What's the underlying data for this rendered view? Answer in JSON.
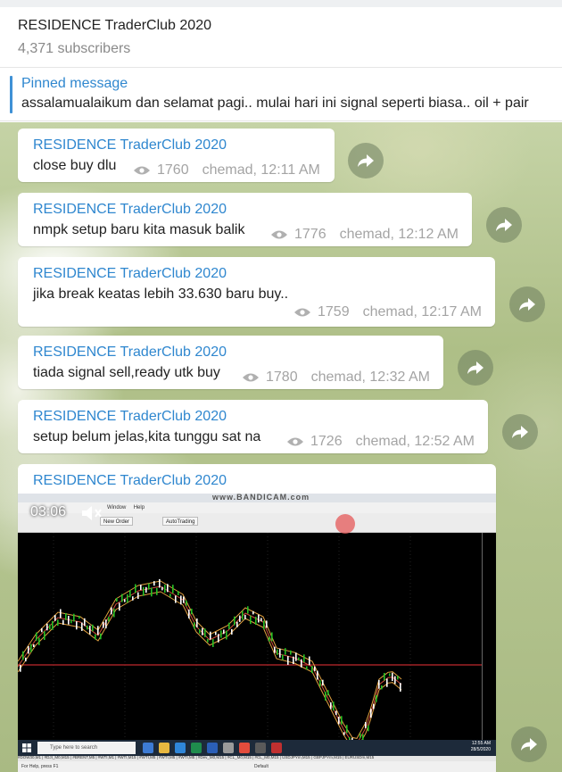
{
  "channel": {
    "title": "RESIDENCE TraderClub 2020",
    "subscribers": "4,371 subscribers"
  },
  "pinned": {
    "label": "Pinned message",
    "text": "assalamualaikum dan selamat pagi.. mulai hari ini signal seperti biasa.. oil + pair"
  },
  "messages": [
    {
      "sender": "RESIDENCE TraderClub 2020",
      "text": "close buy dlu",
      "views": "1760",
      "time": "chemad, 12:11 AM"
    },
    {
      "sender": "RESIDENCE TraderClub 2020",
      "text": "nmpk setup baru kita masuk balik",
      "views": "1776",
      "time": "chemad, 12:12 AM"
    },
    {
      "sender": "RESIDENCE TraderClub 2020",
      "text": "jika break keatas lebih 33.630 baru buy..",
      "views": "1759",
      "time": "chemad, 12:17 AM"
    },
    {
      "sender": "RESIDENCE TraderClub 2020",
      "text": "tiada signal sell,ready utk buy",
      "views": "1780",
      "time": "chemad, 12:32 AM"
    },
    {
      "sender": "RESIDENCE TraderClub 2020",
      "text": "setup belum jelas,kita tunggu sat na",
      "views": "1726",
      "time": "chemad, 12:52 AM"
    },
    {
      "sender": "RESIDENCE TraderClub 2020"
    }
  ],
  "video": {
    "duration": "03:06",
    "watermark": "www.BANDICAM.com",
    "menu_window": "Window",
    "menu_help": "Help",
    "toolbar_new_order": "New Order",
    "toolbar_autotrading": "AutoTrading",
    "status_text": "For Help, press F1",
    "status_profile": "Default",
    "tabs": "#DOW30,M1 | #DJI_M0,M15 | #BRENT,M5 | #WTI,M1 | #WTI,M15 | #WTI,M5 | #WTI,M5 | #WTI,M5 | #Dev_M0,M15 | #CL_M0,M15 | #CL_M0,M15 | USDJPYm,M15 | GBPJPYm,M15 | EURUSDm,M15",
    "taskbar_search": "Type here to search",
    "taskbar_time": "12:55 AM",
    "taskbar_date": "28/5/2020"
  },
  "colors": {
    "accent": "#2f87cf",
    "meta": "#a4a4a4",
    "chart_bull": "#25c025",
    "chart_bear": "#ffffff"
  },
  "icons": [
    "eye-icon",
    "share-icon",
    "volume-icon",
    "windows-start-icon"
  ]
}
